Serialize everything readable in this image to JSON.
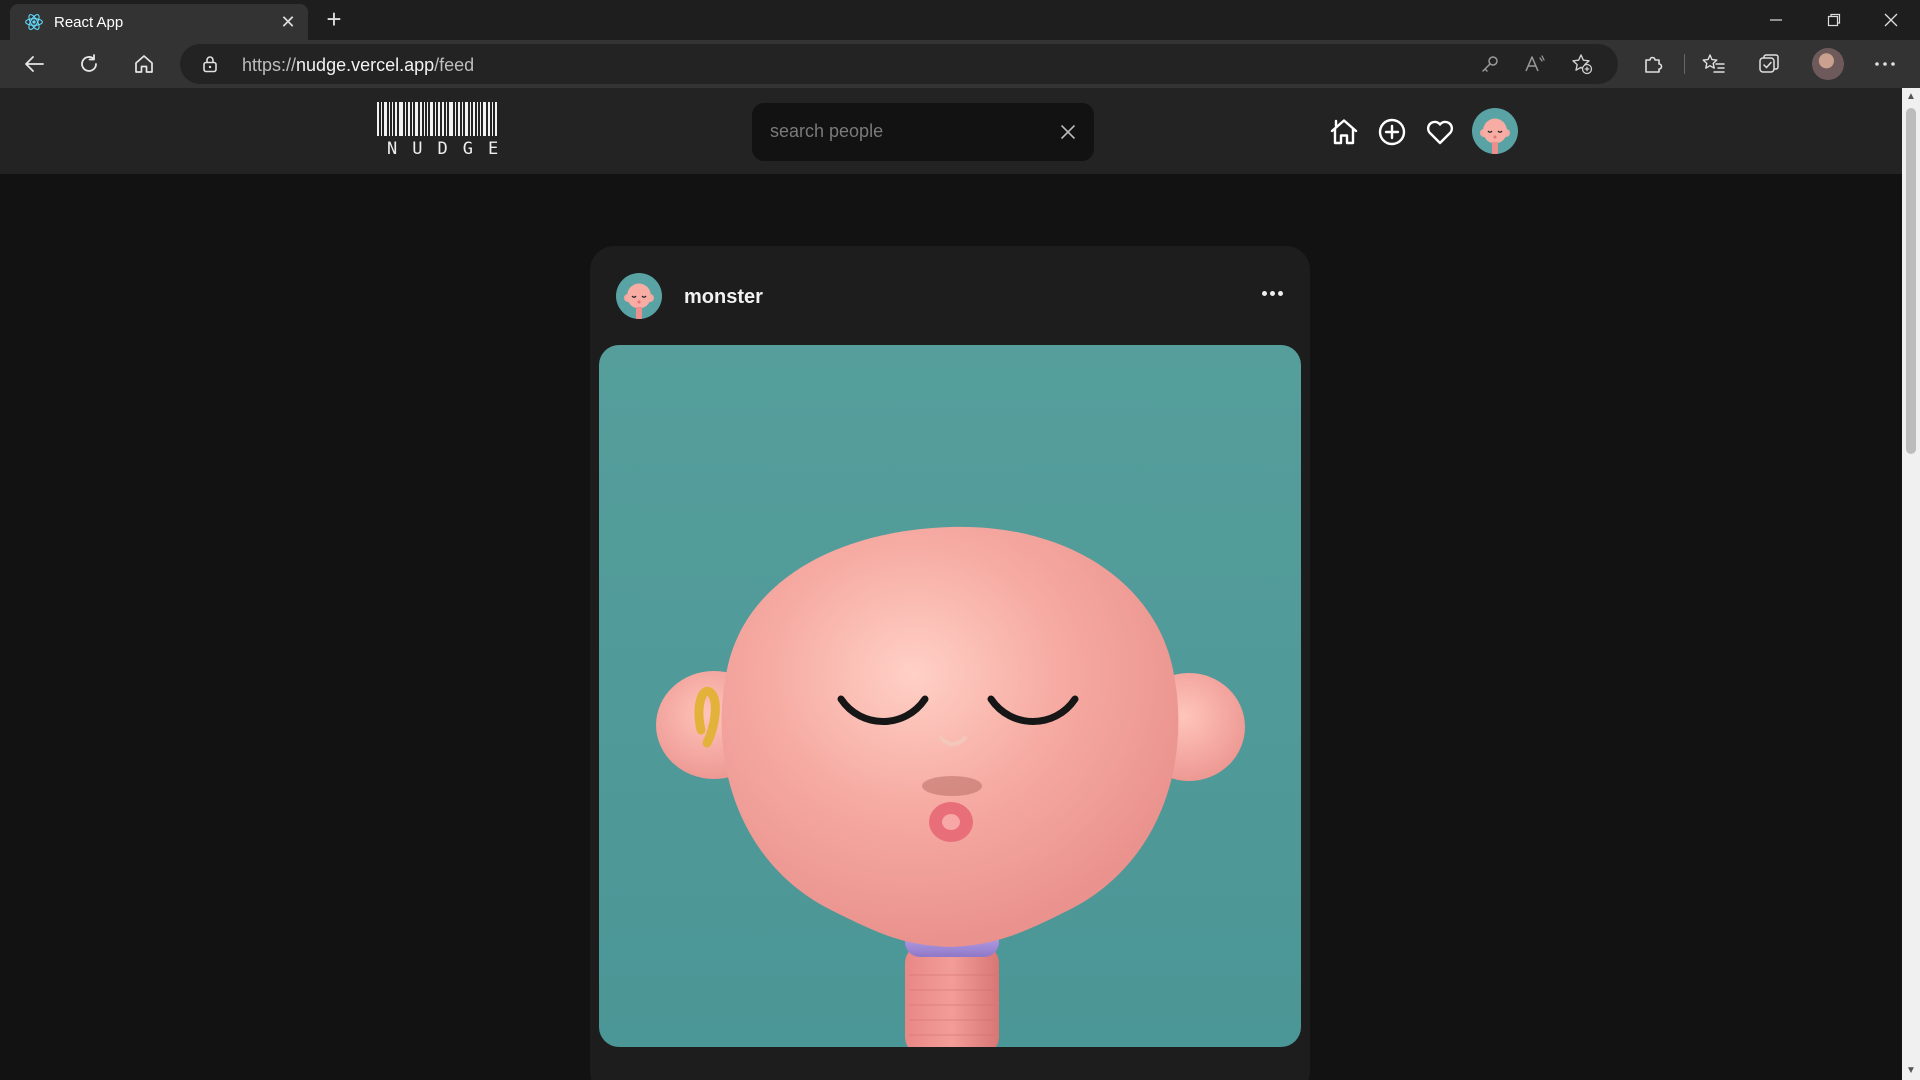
{
  "browser": {
    "tab_title": "React App",
    "url_scheme": "https://",
    "url_host": "nudge.vercel.app",
    "url_path": "/feed"
  },
  "app": {
    "logo_text": "NUDGE",
    "search_placeholder": "search people"
  },
  "post": {
    "username": "monster"
  },
  "icons": {
    "tab_favicon": "react-icon",
    "nav": [
      "home-icon",
      "add-circle-icon",
      "heart-icon"
    ],
    "toolbar": [
      "back-arrow-icon",
      "refresh-icon",
      "home-icon",
      "lock-icon",
      "key-icon",
      "read-aloud-icon",
      "add-favorite-icon",
      "extensions-icon",
      "favorites-icon",
      "collections-icon",
      "more-icon"
    ]
  },
  "colors": {
    "page_bg": "#121212",
    "header_bg": "#232323",
    "card_bg": "#1d1d1d",
    "image_bg": "#559e9c",
    "avatar_bg": "#59a3a4"
  }
}
